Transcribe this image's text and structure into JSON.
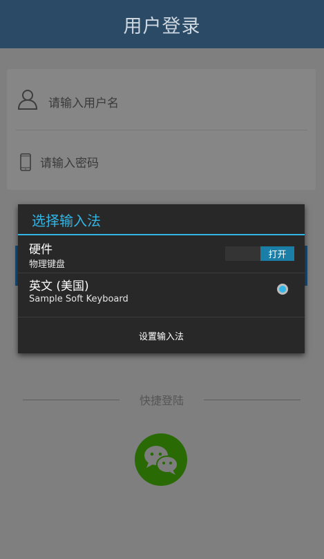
{
  "header": {
    "title": "用户登录"
  },
  "login": {
    "username_placeholder": "请输入用户名",
    "password_placeholder": "请输入密码"
  },
  "quick_login": {
    "label": "快捷登陆"
  },
  "icons": {
    "user": "user-icon",
    "phone": "phone-icon",
    "wechat": "wechat-icon"
  },
  "dialog": {
    "title": "选择输入法",
    "hardware": {
      "title": "硬件",
      "subtitle": "物理键盘",
      "toggle_label": "打开"
    },
    "english": {
      "title": "英文 (美国)",
      "subtitle": "Sample Soft Keyboard",
      "selected": true
    },
    "settings_label": "设置输入法"
  },
  "colors": {
    "accent": "#33b5e5",
    "header_bg": "#2a4a66",
    "wechat_green": "#2a6a05",
    "toggle_on": "#1b7ea6"
  }
}
